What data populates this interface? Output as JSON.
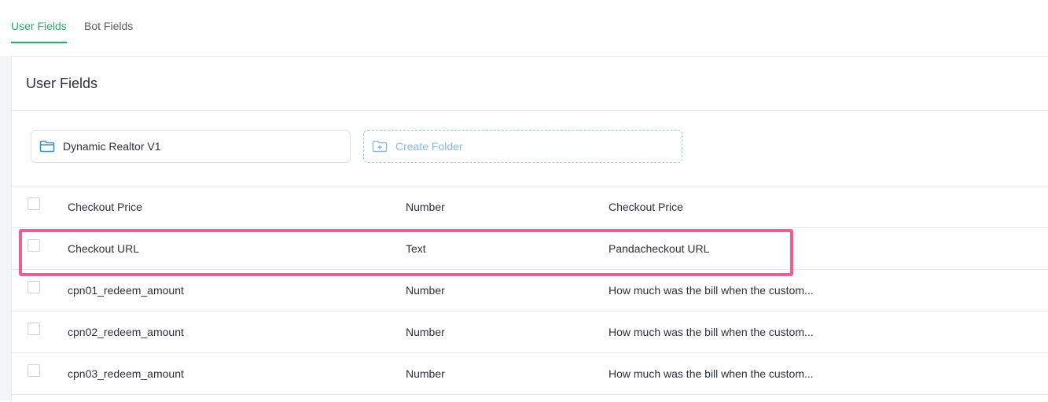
{
  "tabs": [
    {
      "label": "User Fields",
      "active": true
    },
    {
      "label": "Bot Fields",
      "active": false
    }
  ],
  "card": {
    "title": "User Fields"
  },
  "folders": {
    "existing": {
      "label": "Dynamic Realtor V1",
      "icon": "folder-icon"
    },
    "create": {
      "label": "Create Folder",
      "icon": "folder-plus-icon"
    }
  },
  "rows": [
    {
      "name": "Checkout Price",
      "type": "Number",
      "description": "Checkout Price"
    },
    {
      "name": "Checkout URL",
      "type": "Text",
      "description": "Pandacheckout URL"
    },
    {
      "name": "cpn01_redeem_amount",
      "type": "Number",
      "description": "How much was the bill when the custom..."
    },
    {
      "name": "cpn02_redeem_amount",
      "type": "Number",
      "description": "How much was the bill when the custom..."
    },
    {
      "name": "cpn03_redeem_amount",
      "type": "Number",
      "description": "How much was the bill when the custom..."
    }
  ],
  "colors": {
    "accent": "#1fb06a",
    "folder_icon": "#3a8fd9",
    "highlight": "#ee5f8d"
  }
}
